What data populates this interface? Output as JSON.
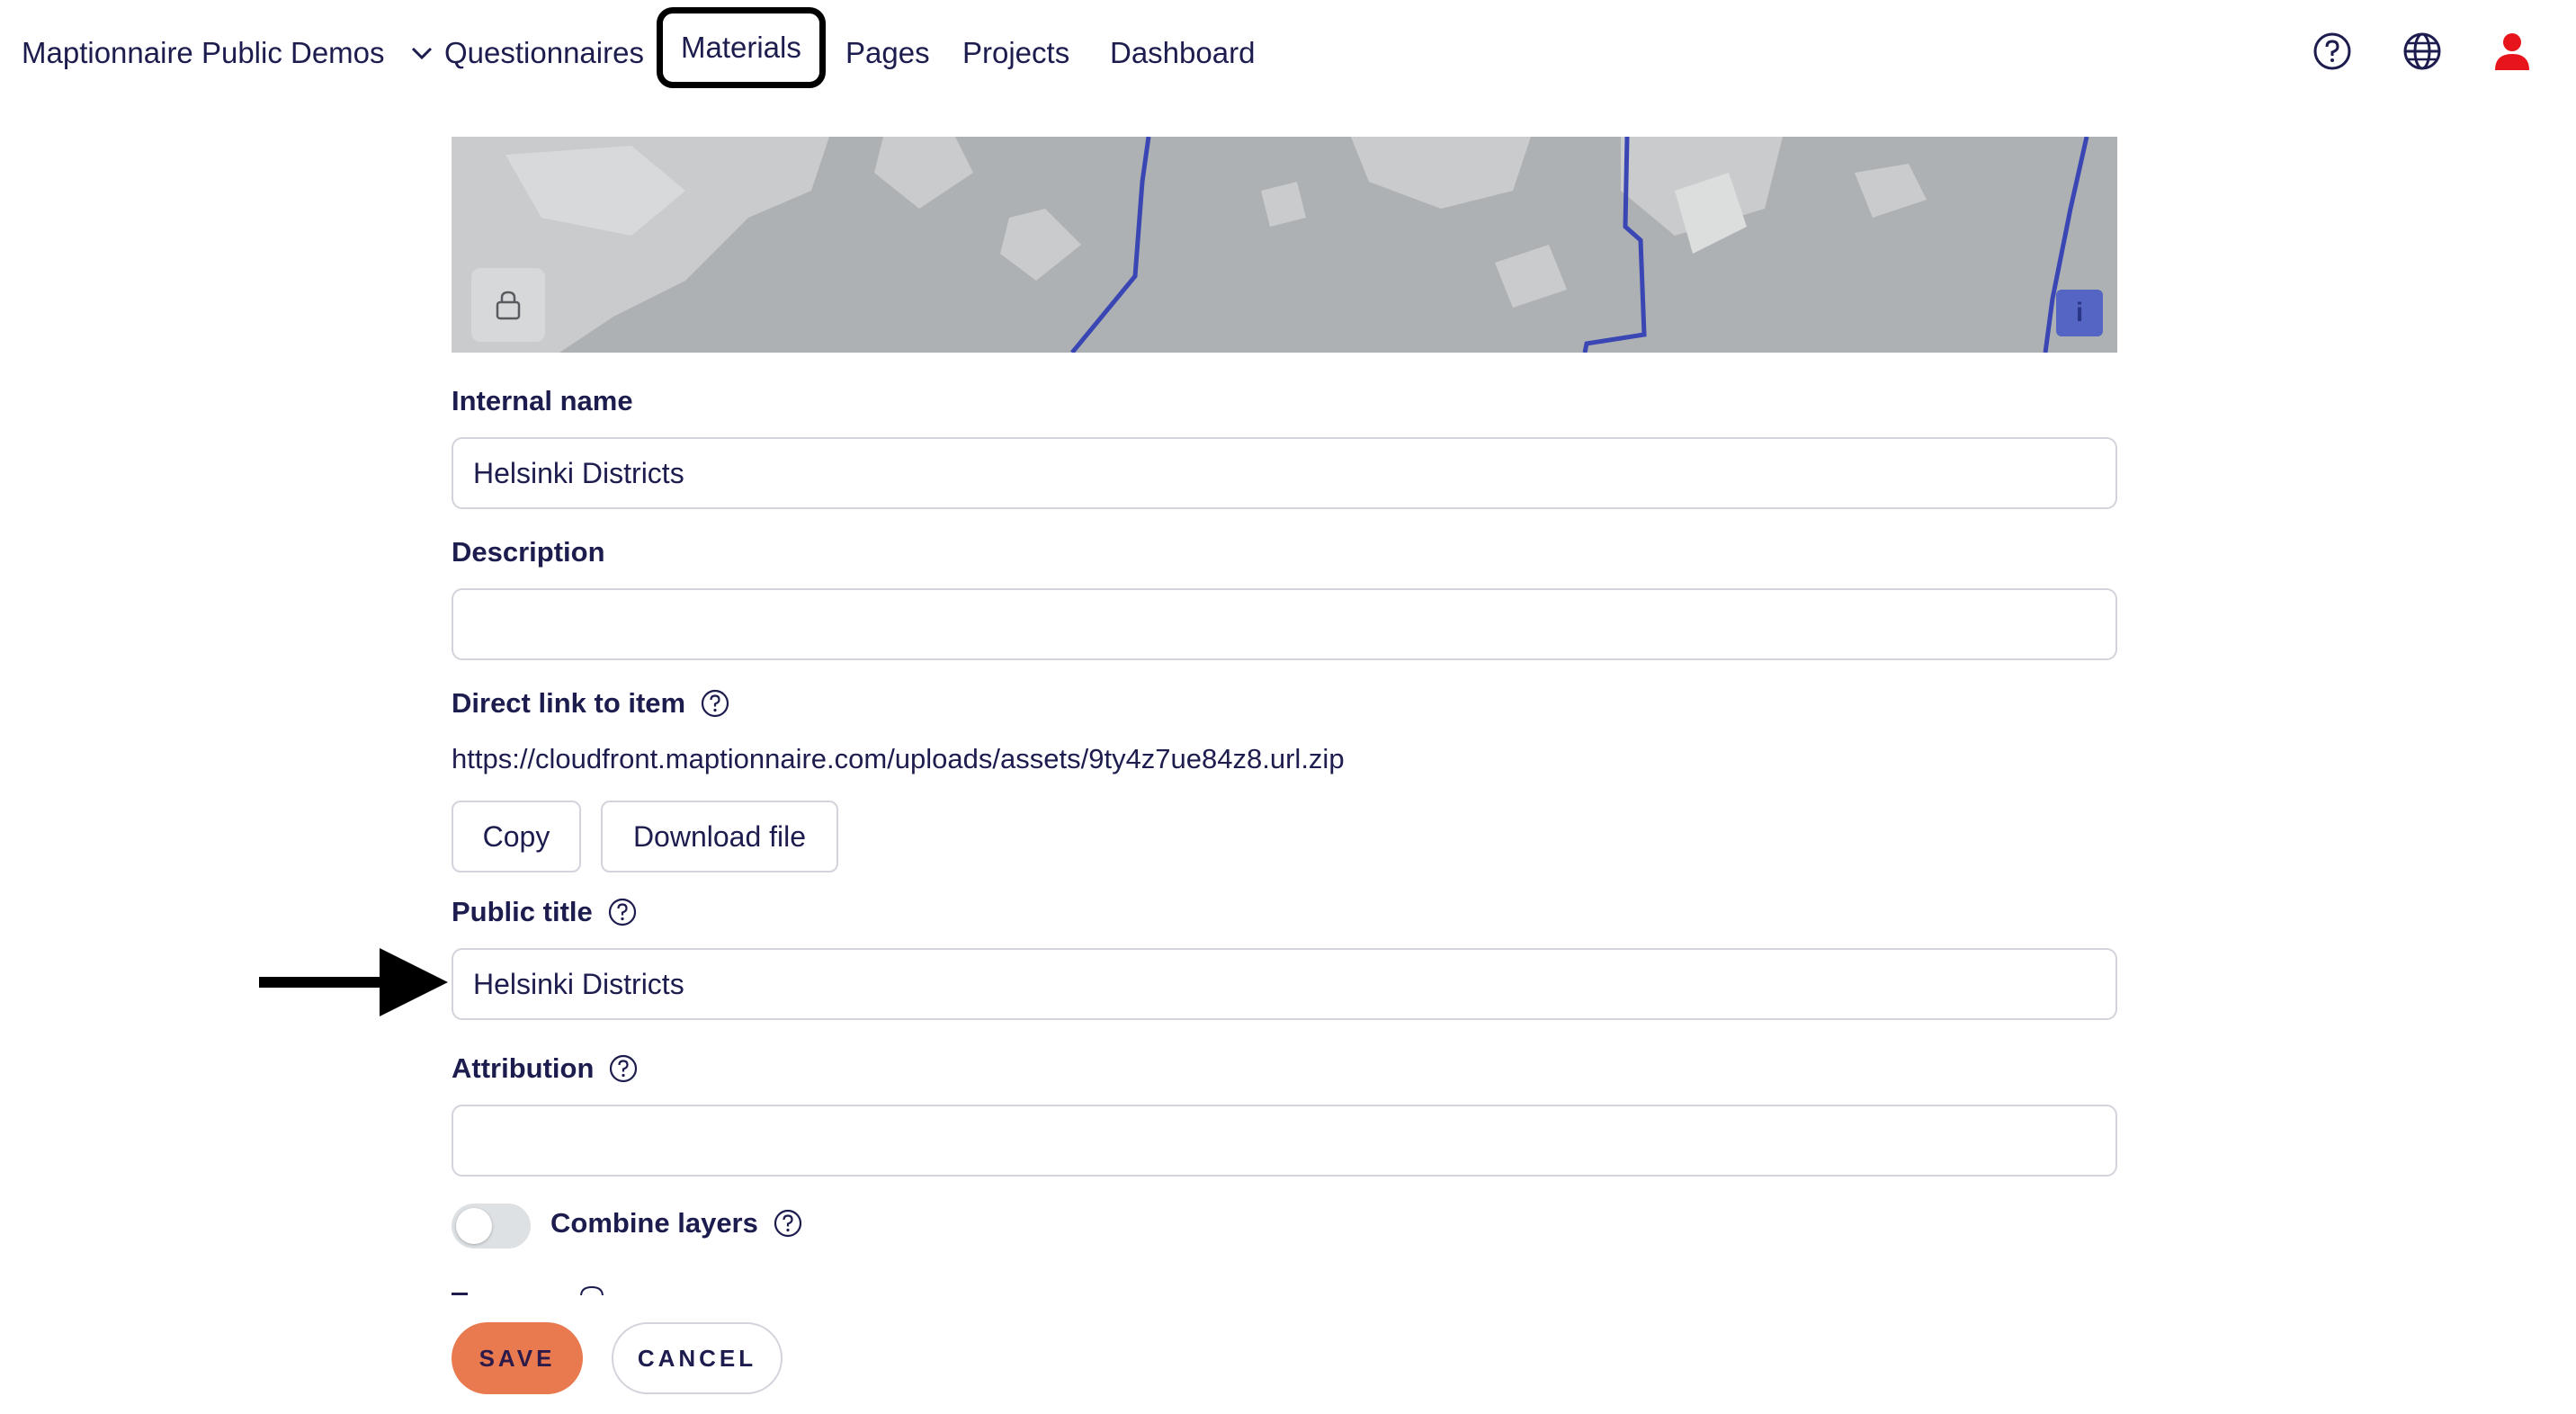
{
  "nav": {
    "org_name": "Maptionnaire Public Demos",
    "links": [
      "Questionnaires",
      "Materials",
      "Pages",
      "Projects",
      "Dashboard"
    ],
    "active": "Materials",
    "icons": [
      "help-circle-icon",
      "globe-icon",
      "user-icon"
    ]
  },
  "map": {
    "lock_icon": "lock-icon",
    "info_label": "i"
  },
  "form": {
    "internal_name_label": "Internal name",
    "internal_name_value": "Helsinki Districts",
    "description_label": "Description",
    "description_value": "",
    "direct_link_label": "Direct link to item",
    "direct_link_value": "https://cloudfront.maptionnaire.com/uploads/assets/9ty4z7ue84z8.url.zip",
    "copy_label": "Copy",
    "download_label": "Download file",
    "public_title_label": "Public title",
    "public_title_value": "Helsinki Districts",
    "attribution_label": "Attribution",
    "attribution_value": "",
    "combine_layers_label": "Combine layers",
    "combine_layers_on": false
  },
  "footer": {
    "save_label": "SAVE",
    "cancel_label": "CANCEL"
  },
  "colors": {
    "text": "#1d1c4e",
    "save": "#e97a4f",
    "user_icon": "#e8141c",
    "map_water": "#aeb1b4",
    "map_lines": "#3a46b4"
  }
}
